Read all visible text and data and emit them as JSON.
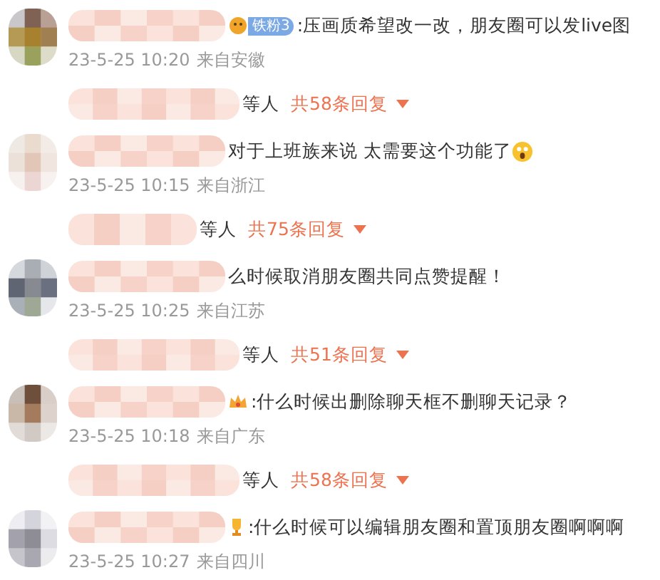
{
  "comments": [
    {
      "badge": {
        "kind": "fan",
        "label": "铁粉3"
      },
      "text": ":压画质希望改一改，朋友圈可以发live图",
      "time": "23-5-25 10:20",
      "location": "来自安徽",
      "replies": {
        "suffix": "等人",
        "count": "共58条回复"
      }
    },
    {
      "badge": {
        "kind": "none"
      },
      "text": "对于上班族来说 太需要这个功能了",
      "emoji": true,
      "time": "23-5-25 10:15",
      "location": "来自浙江",
      "replies": {
        "suffix": "等人",
        "count": "共75条回复"
      }
    },
    {
      "badge": {
        "kind": "none"
      },
      "text": "么时候取消朋友圈共同点赞提醒！",
      "time": "23-5-25 10:25",
      "location": "来自江苏",
      "replies": {
        "suffix": "等人",
        "count": "共51条回复"
      }
    },
    {
      "badge": {
        "kind": "crown"
      },
      "text": ":什么时候出删除聊天框不删聊天记录？",
      "time": "23-5-25 10:18",
      "location": "来自广东",
      "replies": {
        "suffix": "等人",
        "count": "共58条回复"
      }
    },
    {
      "badge": {
        "kind": "trophy"
      },
      "text": ":什么时候可以编辑朋友圈和置顶朋友圈啊啊啊",
      "time": "23-5-25 10:27",
      "location": "来自四川"
    }
  ]
}
